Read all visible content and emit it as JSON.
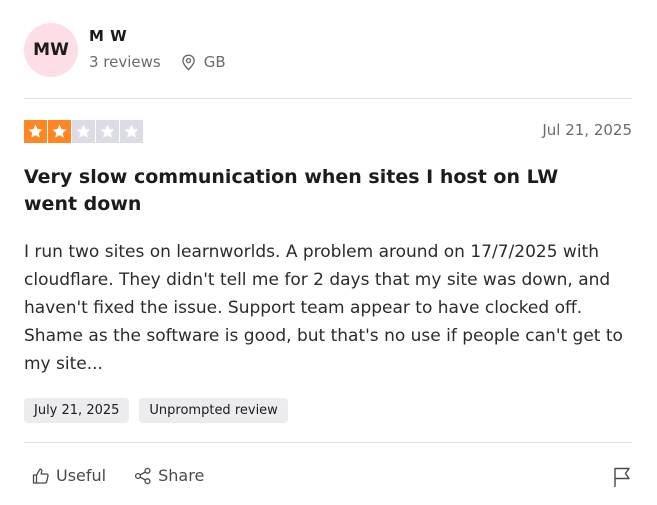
{
  "reviewer": {
    "initials": "MW",
    "name": "M W",
    "reviews": "3 reviews",
    "country": "GB",
    "avatar_color": "#fddde6"
  },
  "rating": {
    "stars": 2,
    "max": 5,
    "filled_color": "#ff8622",
    "empty_color": "#dcdce6"
  },
  "review": {
    "date": "Jul 21, 2025",
    "title": "Very slow communication when sites I host on LW went down",
    "body": "I run two sites on learnworlds. A problem around on 17/7/2025 with cloudflare. They didn't tell me for 2 days that my site was down, and haven't fixed the issue. Support team appear to have clocked off. Shame as the software is good, but that's no use if people can't get to my site...",
    "tags": [
      "July 21, 2025",
      "Unprompted review"
    ]
  },
  "actions": {
    "useful_label": "Useful",
    "share_label": "Share",
    "icons": [
      "thumbs-up-icon",
      "share-icon",
      "flag-icon",
      "location-pin-icon",
      "star-icon"
    ]
  }
}
